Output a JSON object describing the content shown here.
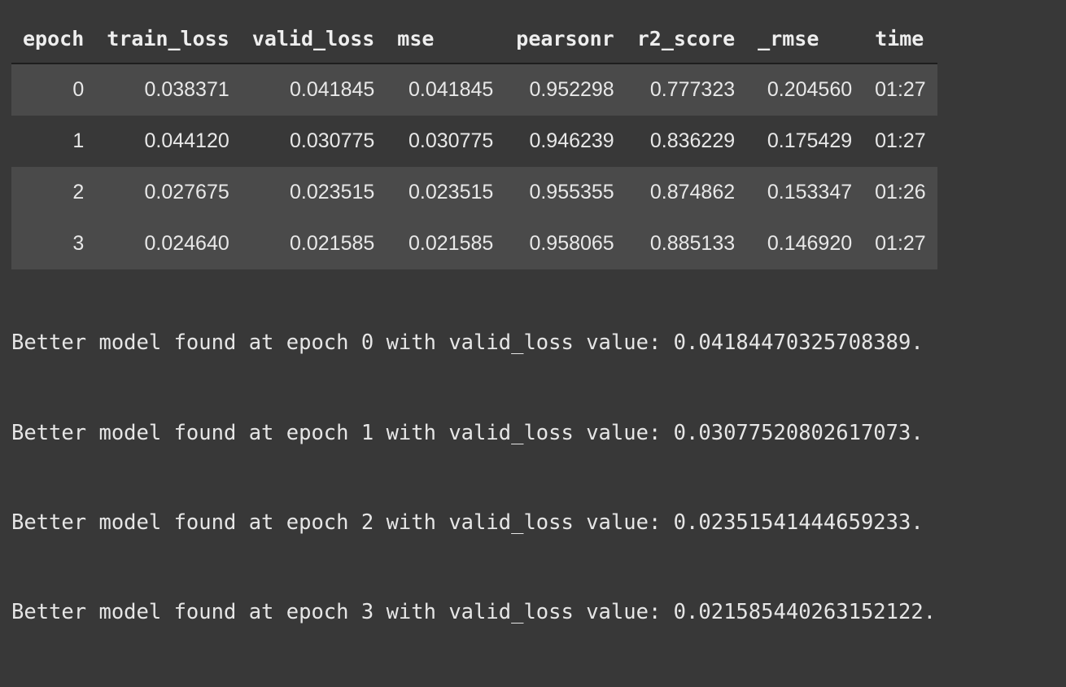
{
  "table": {
    "columns": [
      "epoch",
      "train_loss",
      "valid_loss",
      "mse",
      "pearsonr",
      "r2_score",
      "_rmse",
      "time"
    ],
    "rows": [
      [
        "0",
        "0.038371",
        "0.041845",
        "0.041845",
        "0.952298",
        "0.777323",
        "0.204560",
        "01:27"
      ],
      [
        "1",
        "0.044120",
        "0.030775",
        "0.030775",
        "0.946239",
        "0.836229",
        "0.175429",
        "01:27"
      ],
      [
        "2",
        "0.027675",
        "0.023515",
        "0.023515",
        "0.955355",
        "0.874862",
        "0.153347",
        "01:26"
      ],
      [
        "3",
        "0.024640",
        "0.021585",
        "0.021585",
        "0.958065",
        "0.885133",
        "0.146920",
        "01:27"
      ]
    ]
  },
  "log": [
    "Better model found at epoch 0 with valid_loss value: 0.04184470325708389.",
    "Better model found at epoch 1 with valid_loss value: 0.03077520802617073.",
    "Better model found at epoch 2 with valid_loss value: 0.02351541444659233.",
    "Better model found at epoch 3 with valid_loss value: 0.021585440263152122."
  ],
  "colors": {
    "background": "#383838",
    "row_stripe": "#4a4a4a",
    "text": "#e6e6e6"
  }
}
